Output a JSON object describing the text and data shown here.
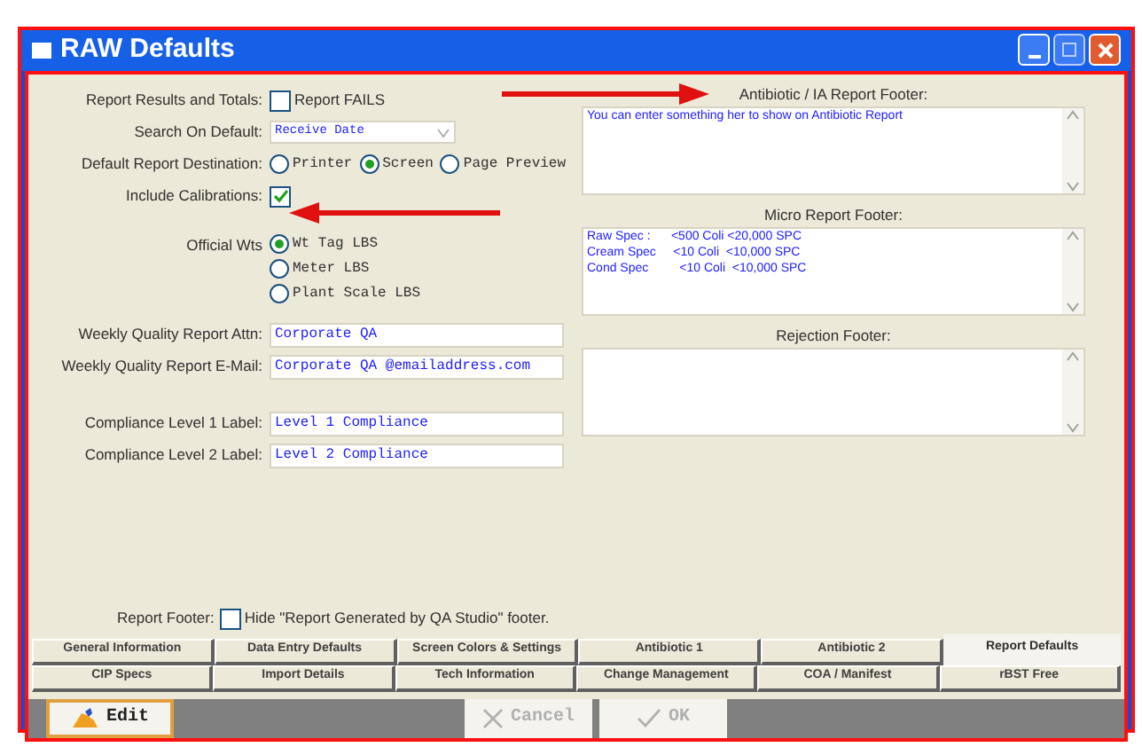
{
  "window": {
    "title": "RAW Defaults"
  },
  "report_results": {
    "label": "Report Results and Totals:",
    "option": "Report FAILS",
    "checked": false
  },
  "search_on_default": {
    "label": "Search On Default:",
    "value": "Receive Date"
  },
  "default_report_destination": {
    "label": "Default Report Destination:",
    "options": [
      {
        "label": "Printer",
        "selected": false
      },
      {
        "label": "Screen",
        "selected": true
      },
      {
        "label": "Page Preview",
        "selected": false
      }
    ]
  },
  "include_calibrations": {
    "label": "Include Calibrations:",
    "checked": true
  },
  "official_wts": {
    "label": "Official Wts",
    "options": [
      {
        "label": "Wt Tag LBS",
        "selected": true
      },
      {
        "label": "Meter LBS",
        "selected": false
      },
      {
        "label": "Plant Scale LBS",
        "selected": false
      }
    ]
  },
  "text_fields": [
    {
      "label": "Weekly Quality Report Attn:",
      "value": "Corporate QA"
    },
    {
      "label": "Weekly Quality Report E-Mail:",
      "value": "Corporate QA @emailaddress.com"
    },
    {
      "label": "Compliance Level 1 Label:",
      "value": "Level 1 Compliance"
    },
    {
      "label": "Compliance Level 2 Label:",
      "value": "Level 2 Compliance"
    }
  ],
  "report_footer": {
    "label": "Report Footer:",
    "option": "Hide \"Report Generated by QA Studio\" footer.",
    "checked": false
  },
  "footers": [
    {
      "label": "Antibiotic / IA Report Footer:",
      "lines": [
        "You can enter something her to show on Antibiotic Report"
      ]
    },
    {
      "label": "Micro Report Footer:",
      "lines": [
        "Raw Spec :      <500 Coli <20,000 SPC",
        "Cream Spec     <10 Coli  <10,000 SPC",
        "Cond Spec         <10 Coli  <10,000 SPC"
      ]
    },
    {
      "label": "Rejection Footer:"
    }
  ],
  "tab_rows": [
    [
      {
        "label": "General Information",
        "selected": false
      },
      {
        "label": "Data Entry Defaults",
        "selected": false
      },
      {
        "label": "Screen Colors & Settings",
        "selected": false
      },
      {
        "label": "Antibiotic 1",
        "selected": false
      },
      {
        "label": "Antibiotic 2",
        "selected": false
      },
      {
        "label": "Report Defaults",
        "selected": true
      }
    ],
    [
      {
        "label": "CIP Specs",
        "selected": false
      },
      {
        "label": "Import Details",
        "selected": false
      },
      {
        "label": "Tech Information",
        "selected": false
      },
      {
        "label": "Change Management",
        "selected": false
      },
      {
        "label": "COA / Manifest",
        "selected": false
      },
      {
        "label": "rBST Free",
        "selected": false
      }
    ]
  ],
  "buttons": [
    {
      "kind": "edit",
      "label": "Edit",
      "disabled": false
    },
    {
      "kind": "cancel",
      "label": "Cancel",
      "disabled": true
    },
    {
      "kind": "ok",
      "label": "OK",
      "disabled": true
    }
  ]
}
